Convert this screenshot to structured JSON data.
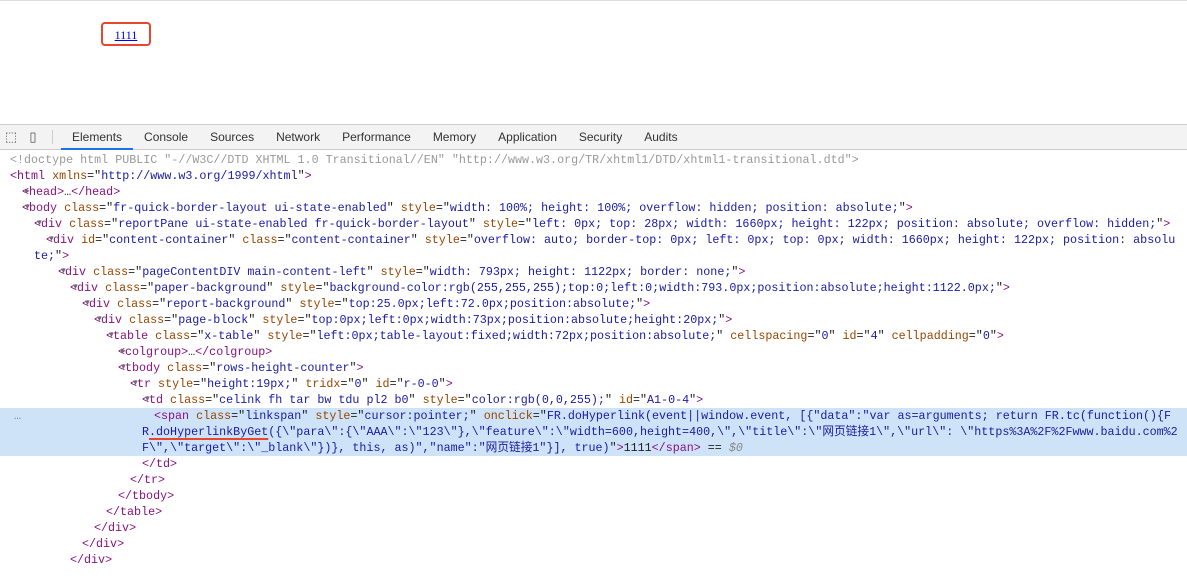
{
  "page": {
    "link_text": "1111"
  },
  "toolbar": {
    "tabs": [
      "Elements",
      "Console",
      "Sources",
      "Network",
      "Performance",
      "Memory",
      "Application",
      "Security",
      "Audits"
    ],
    "active": "Elements"
  },
  "code": {
    "lines": [
      {
        "i": 0,
        "ar": "",
        "tk": [
          [
            "g",
            "<!doctype html PUBLIC \"-//W3C//DTD XHTML 1.0 Transitional//EN\" \"http://www.w3.org/TR/xhtml1/DTD/xhtml1-transitional.dtd\">"
          ]
        ]
      },
      {
        "i": 0,
        "ar": "",
        "tk": [
          [
            "t",
            "<html"
          ],
          [
            "a",
            " xmlns"
          ],
          [
            "x",
            "=\""
          ],
          [
            "v",
            "http://www.w3.org/1999/xhtml"
          ],
          [
            "x",
            "\""
          ],
          [
            "t",
            ">"
          ]
        ]
      },
      {
        "i": 1,
        "ar": "▶",
        "tk": [
          [
            "t",
            "<head>"
          ],
          [
            "x",
            "…"
          ],
          [
            "t",
            "</head>"
          ]
        ]
      },
      {
        "i": 1,
        "ar": "▼",
        "tk": [
          [
            "t",
            "<body"
          ],
          [
            "a",
            " class"
          ],
          [
            "x",
            "=\""
          ],
          [
            "v",
            "fr-quick-border-layout ui-state-enabled"
          ],
          [
            "x",
            "\""
          ],
          [
            "a",
            " style"
          ],
          [
            "x",
            "=\""
          ],
          [
            "v",
            "width: 100%; height: 100%; overflow: hidden; position: absolute;"
          ],
          [
            "x",
            "\""
          ],
          [
            "t",
            ">"
          ]
        ]
      },
      {
        "i": 2,
        "ar": "▼",
        "tk": [
          [
            "t",
            "<div"
          ],
          [
            "a",
            " class"
          ],
          [
            "x",
            "=\""
          ],
          [
            "v",
            "reportPane ui-state-enabled fr-quick-border-layout"
          ],
          [
            "x",
            "\""
          ],
          [
            "a",
            " style"
          ],
          [
            "x",
            "=\""
          ],
          [
            "v",
            "left: 0px; top: 28px; width: 1660px; height: 122px; position: absolute; overflow: hidden;"
          ],
          [
            "x",
            "\""
          ],
          [
            "t",
            ">"
          ]
        ]
      },
      {
        "i": 3,
        "ar": "▼",
        "tk": [
          [
            "t",
            "<div"
          ],
          [
            "a",
            " id"
          ],
          [
            "x",
            "=\""
          ],
          [
            "v",
            "content-container"
          ],
          [
            "x",
            "\""
          ],
          [
            "a",
            " class"
          ],
          [
            "x",
            "=\""
          ],
          [
            "v",
            "content-container"
          ],
          [
            "x",
            "\""
          ],
          [
            "a",
            " style"
          ],
          [
            "x",
            "=\""
          ],
          [
            "v",
            "overflow: auto; border-top: 0px; left: 0px; top: 0px; width: 1660px; height: 122px; position: absolute;"
          ],
          [
            "x",
            "\""
          ],
          [
            "t",
            ">"
          ]
        ]
      },
      {
        "i": 4,
        "ar": "▼",
        "tk": [
          [
            "t",
            "<div"
          ],
          [
            "a",
            " class"
          ],
          [
            "x",
            "=\""
          ],
          [
            "v",
            "pageContentDIV main-content-left"
          ],
          [
            "x",
            "\""
          ],
          [
            "a",
            " style"
          ],
          [
            "x",
            "=\""
          ],
          [
            "v",
            "width: 793px; height: 1122px; border: none;"
          ],
          [
            "x",
            "\""
          ],
          [
            "t",
            ">"
          ]
        ]
      },
      {
        "i": 5,
        "ar": "▼",
        "tk": [
          [
            "t",
            "<div"
          ],
          [
            "a",
            " class"
          ],
          [
            "x",
            "=\""
          ],
          [
            "v",
            "paper-background"
          ],
          [
            "x",
            "\""
          ],
          [
            "a",
            " style"
          ],
          [
            "x",
            "=\""
          ],
          [
            "v",
            "background-color:rgb(255,255,255);top:0;left:0;width:793.0px;position:absolute;height:1122.0px;"
          ],
          [
            "x",
            "\""
          ],
          [
            "t",
            ">"
          ]
        ]
      },
      {
        "i": 6,
        "ar": "▼",
        "tk": [
          [
            "t",
            "<div"
          ],
          [
            "a",
            " class"
          ],
          [
            "x",
            "=\""
          ],
          [
            "v",
            "report-background"
          ],
          [
            "x",
            "\""
          ],
          [
            "a",
            " style"
          ],
          [
            "x",
            "=\""
          ],
          [
            "v",
            "top:25.0px;left:72.0px;position:absolute;"
          ],
          [
            "x",
            "\""
          ],
          [
            "t",
            ">"
          ]
        ]
      },
      {
        "i": 7,
        "ar": "▼",
        "tk": [
          [
            "t",
            "<div"
          ],
          [
            "a",
            " class"
          ],
          [
            "x",
            "=\""
          ],
          [
            "v",
            "page-block"
          ],
          [
            "x",
            "\""
          ],
          [
            "a",
            " style"
          ],
          [
            "x",
            "=\""
          ],
          [
            "v",
            "top:0px;left:0px;width:73px;position:absolute;height:20px;"
          ],
          [
            "x",
            "\""
          ],
          [
            "t",
            ">"
          ]
        ]
      },
      {
        "i": 8,
        "ar": "▼",
        "tk": [
          [
            "t",
            "<table"
          ],
          [
            "a",
            " class"
          ],
          [
            "x",
            "=\""
          ],
          [
            "v",
            "x-table"
          ],
          [
            "x",
            "\""
          ],
          [
            "a",
            " style"
          ],
          [
            "x",
            "=\""
          ],
          [
            "v",
            "left:0px;table-layout:fixed;width:72px;position:absolute;"
          ],
          [
            "x",
            "\""
          ],
          [
            "a",
            " cellspacing"
          ],
          [
            "x",
            "=\""
          ],
          [
            "v",
            "0"
          ],
          [
            "x",
            "\""
          ],
          [
            "a",
            " id"
          ],
          [
            "x",
            "=\""
          ],
          [
            "v",
            "4"
          ],
          [
            "x",
            "\""
          ],
          [
            "a",
            " cellpadding"
          ],
          [
            "x",
            "=\""
          ],
          [
            "v",
            "0"
          ],
          [
            "x",
            "\""
          ],
          [
            "t",
            ">"
          ]
        ]
      },
      {
        "i": 9,
        "ar": "▶",
        "tk": [
          [
            "t",
            "<colgroup>"
          ],
          [
            "x",
            "…"
          ],
          [
            "t",
            "</colgroup>"
          ]
        ]
      },
      {
        "i": 9,
        "ar": "▼",
        "tk": [
          [
            "t",
            "<tbody"
          ],
          [
            "a",
            " class"
          ],
          [
            "x",
            "=\""
          ],
          [
            "v",
            "rows-height-counter"
          ],
          [
            "x",
            "\""
          ],
          [
            "t",
            ">"
          ]
        ]
      },
      {
        "i": 10,
        "ar": "▼",
        "tk": [
          [
            "t",
            "<tr"
          ],
          [
            "a",
            " style"
          ],
          [
            "x",
            "=\""
          ],
          [
            "v",
            "height:19px;"
          ],
          [
            "x",
            "\""
          ],
          [
            "a",
            " tridx"
          ],
          [
            "x",
            "=\""
          ],
          [
            "v",
            "0"
          ],
          [
            "x",
            "\""
          ],
          [
            "a",
            " id"
          ],
          [
            "x",
            "=\""
          ],
          [
            "v",
            "r-0-0"
          ],
          [
            "x",
            "\""
          ],
          [
            "t",
            ">"
          ]
        ]
      },
      {
        "i": 11,
        "ar": "▼",
        "tk": [
          [
            "t",
            "<td"
          ],
          [
            "a",
            " class"
          ],
          [
            "x",
            "=\""
          ],
          [
            "v",
            "celink fh tar bw tdu pl2 b0"
          ],
          [
            "x",
            "\""
          ],
          [
            "a",
            " style"
          ],
          [
            "x",
            "=\""
          ],
          [
            "v",
            "color:rgb(0,0,255);"
          ],
          [
            "x",
            "\""
          ],
          [
            "a",
            " id"
          ],
          [
            "x",
            "=\""
          ],
          [
            "v",
            "A1-0-4"
          ],
          [
            "x",
            "\""
          ],
          [
            "t",
            ">"
          ]
        ]
      },
      {
        "i": 12,
        "ar": "",
        "sel": true,
        "tk": [
          [
            "t",
            "<span"
          ],
          [
            "a",
            " class"
          ],
          [
            "x",
            "=\""
          ],
          [
            "v",
            "linkspan"
          ],
          [
            "x",
            "\""
          ],
          [
            "a",
            " style"
          ],
          [
            "x",
            "=\""
          ],
          [
            "v",
            "cursor:pointer;"
          ],
          [
            "x",
            "\""
          ],
          [
            "a",
            " onclick"
          ],
          [
            "x",
            "=\""
          ],
          [
            "v",
            "FR.doHyperlink(event||window.event, [{\"data\":\"var as=arguments; return FR.tc(function(){FR"
          ],
          [
            "vu",
            ".doHyperlinkByGet"
          ],
          [
            "v",
            "({\\\"para\\\":{\\\"AAA\\\":\\\"123\\\"},\\\"feature\\\":\\\"width=600,height=400,\\\",\\\"title\\\":\\\"网页链接1\\\",\\\"url\\\": \\\"https%3A%2F%2Fwww.baidu.com%2F\\\",\\\"target\\\":\\\"_blank\\\"})}, this, as)\",\"name\":\"网页链接1\"}], true)"
          ],
          [
            "x",
            "\""
          ],
          [
            "t",
            ">"
          ],
          [
            "x",
            "1111"
          ],
          [
            "t",
            "</span>"
          ],
          [
            "x",
            " == "
          ],
          [
            "d",
            "$0"
          ]
        ]
      },
      {
        "i": 11,
        "ar": "",
        "tk": [
          [
            "t",
            "</td>"
          ]
        ]
      },
      {
        "i": 10,
        "ar": "",
        "tk": [
          [
            "t",
            "</tr>"
          ]
        ]
      },
      {
        "i": 9,
        "ar": "",
        "tk": [
          [
            "t",
            "</tbody>"
          ]
        ]
      },
      {
        "i": 8,
        "ar": "",
        "tk": [
          [
            "t",
            "</table>"
          ]
        ]
      },
      {
        "i": 7,
        "ar": "",
        "tk": [
          [
            "t",
            "</div>"
          ]
        ]
      },
      {
        "i": 6,
        "ar": "",
        "tk": [
          [
            "t",
            "</div>"
          ]
        ]
      },
      {
        "i": 5,
        "ar": "",
        "tk": [
          [
            "t",
            "</div>"
          ]
        ]
      }
    ]
  }
}
